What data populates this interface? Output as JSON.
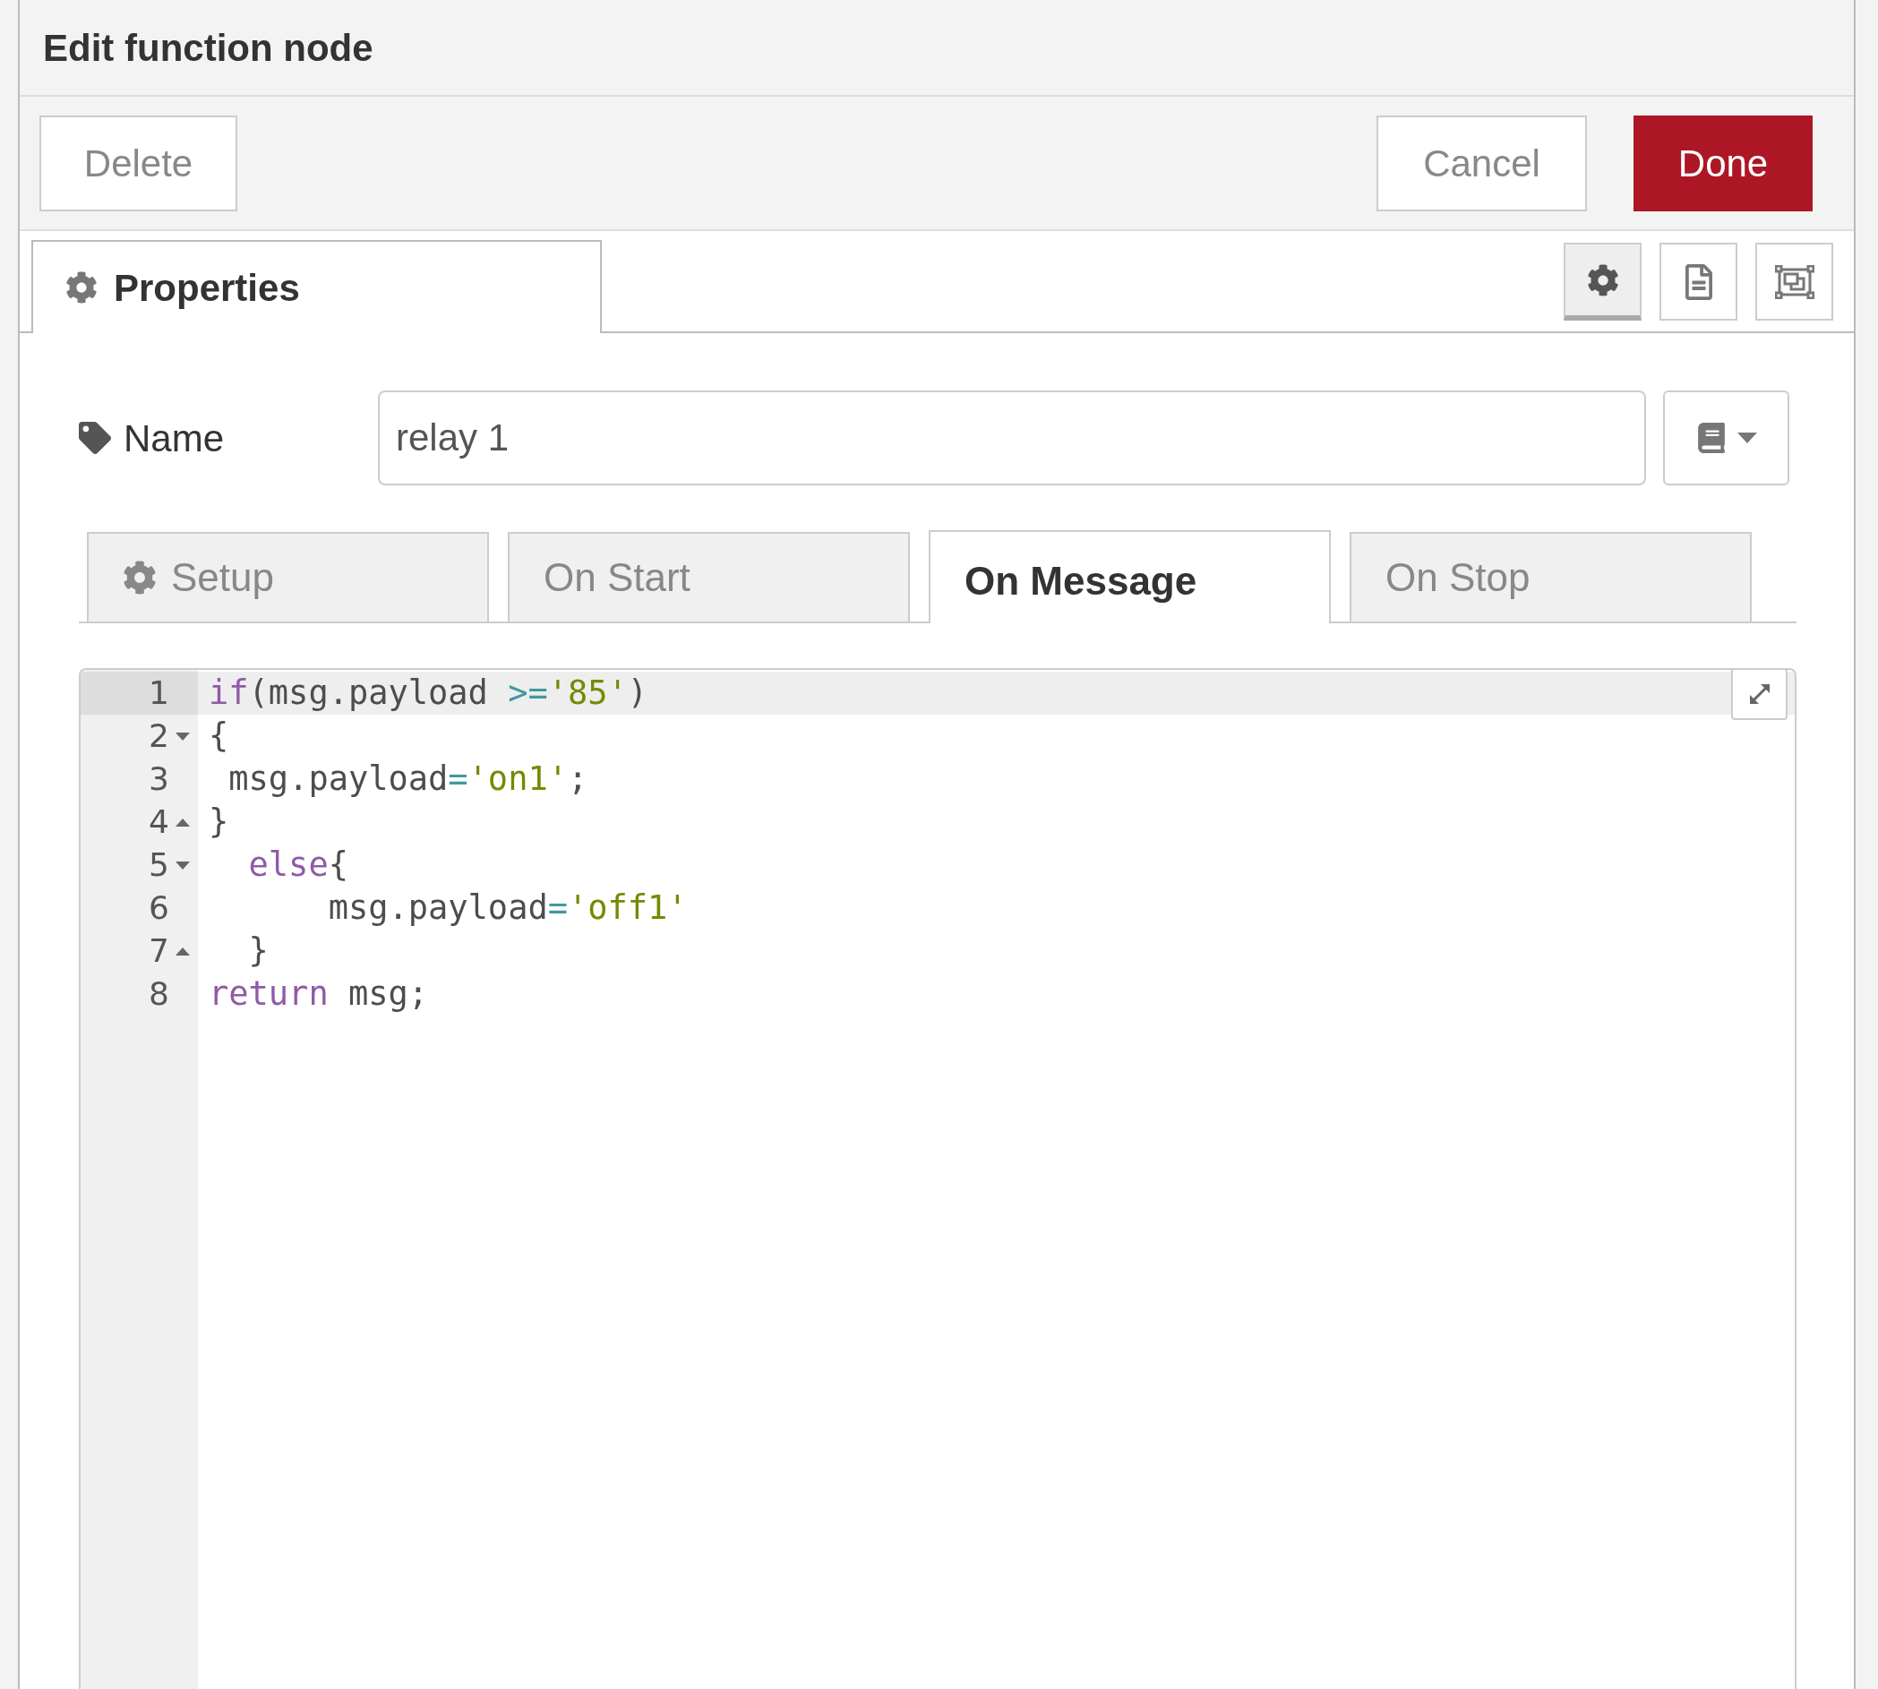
{
  "dialog": {
    "title": "Edit function node"
  },
  "actions": {
    "delete": "Delete",
    "cancel": "Cancel",
    "done": "Done"
  },
  "tray_tabs": [
    {
      "label": "Properties",
      "selected": true
    }
  ],
  "side_buttons": [
    {
      "kind": "settings",
      "selected": true
    },
    {
      "kind": "description",
      "selected": false
    },
    {
      "kind": "appearance",
      "selected": false
    }
  ],
  "name_field": {
    "label": "Name",
    "value": "relay 1"
  },
  "code_tabs": [
    {
      "label": "Setup",
      "icon": true,
      "selected": false
    },
    {
      "label": "On Start",
      "icon": false,
      "selected": false
    },
    {
      "label": "On Message",
      "icon": false,
      "selected": true
    },
    {
      "label": "On Stop",
      "icon": false,
      "selected": false
    }
  ],
  "code_lines": [
    {
      "number": "1",
      "kind": "plain",
      "active": true,
      "tokens": [
        {
          "kind": "keyword",
          "text": "if"
        },
        {
          "kind": "plain",
          "text": "(msg.payload "
        },
        {
          "kind": "operator",
          "text": ">="
        },
        {
          "kind": "string",
          "text": "'85'"
        },
        {
          "kind": "plain",
          "text": ")"
        }
      ]
    },
    {
      "number": "2",
      "kind": "start",
      "active": false,
      "tokens": [
        {
          "kind": "plain",
          "text": "{"
        }
      ]
    },
    {
      "number": "3",
      "kind": "plain",
      "active": false,
      "tokens": [
        {
          "kind": "plain",
          "text": " msg.payload"
        },
        {
          "kind": "operator",
          "text": "="
        },
        {
          "kind": "string",
          "text": "'on1'"
        },
        {
          "kind": "plain",
          "text": ";"
        }
      ]
    },
    {
      "number": "4",
      "kind": "end",
      "active": false,
      "tokens": [
        {
          "kind": "plain",
          "text": "}"
        }
      ]
    },
    {
      "number": "5",
      "kind": "start",
      "active": false,
      "tokens": [
        {
          "kind": "keyword",
          "text": "  else"
        },
        {
          "kind": "plain",
          "text": "{"
        }
      ]
    },
    {
      "number": "6",
      "kind": "plain",
      "active": false,
      "tokens": [
        {
          "kind": "plain",
          "text": "      msg.payload"
        },
        {
          "kind": "operator",
          "text": "="
        },
        {
          "kind": "string",
          "text": "'off1'"
        }
      ]
    },
    {
      "number": "7",
      "kind": "end",
      "active": false,
      "tokens": [
        {
          "kind": "plain",
          "text": "  }"
        }
      ]
    },
    {
      "number": "8",
      "kind": "plain",
      "active": false,
      "tokens": [
        {
          "kind": "keyword",
          "text": "return"
        },
        {
          "kind": "plain",
          "text": " msg;"
        }
      ]
    }
  ]
}
